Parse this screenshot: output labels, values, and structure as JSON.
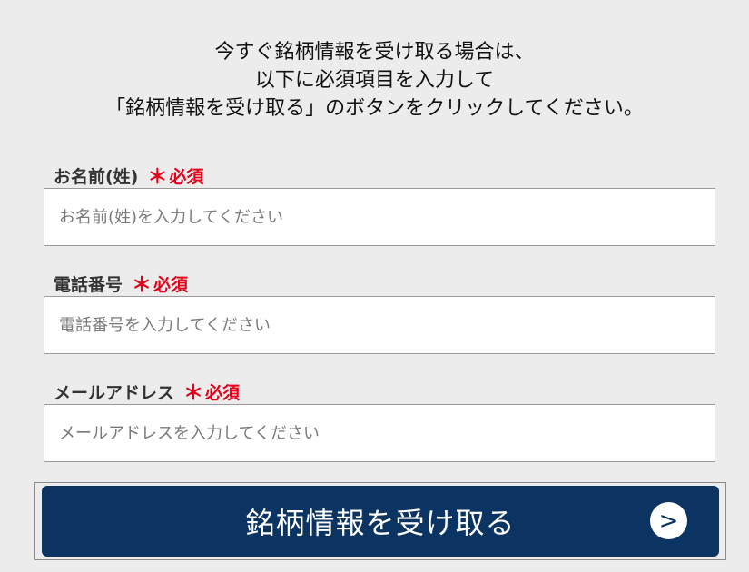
{
  "intro": {
    "line1": "今すぐ銘柄情報を受け取る場合は、",
    "line2": "以下に必須項目を入力して",
    "line3": "「銘柄情報を受け取る」のボタンをクリックしてください。"
  },
  "form": {
    "required_asterisk": "＊",
    "required_text": "必須",
    "fields": [
      {
        "label": "お名前(姓)",
        "placeholder": "お名前(姓)を入力してください",
        "value": ""
      },
      {
        "label": "電話番号",
        "placeholder": "電話番号を入力してください",
        "value": ""
      },
      {
        "label": "メールアドレス",
        "placeholder": "メールアドレスを入力してください",
        "value": ""
      }
    ],
    "submit_label": "銘柄情報を受け取る",
    "submit_arrow_icon": "chevron-right-icon",
    "submit_arrow_glyph": ">"
  },
  "colors": {
    "background": "#ececec",
    "button": "#0c3462",
    "required": "#e3001b"
  }
}
